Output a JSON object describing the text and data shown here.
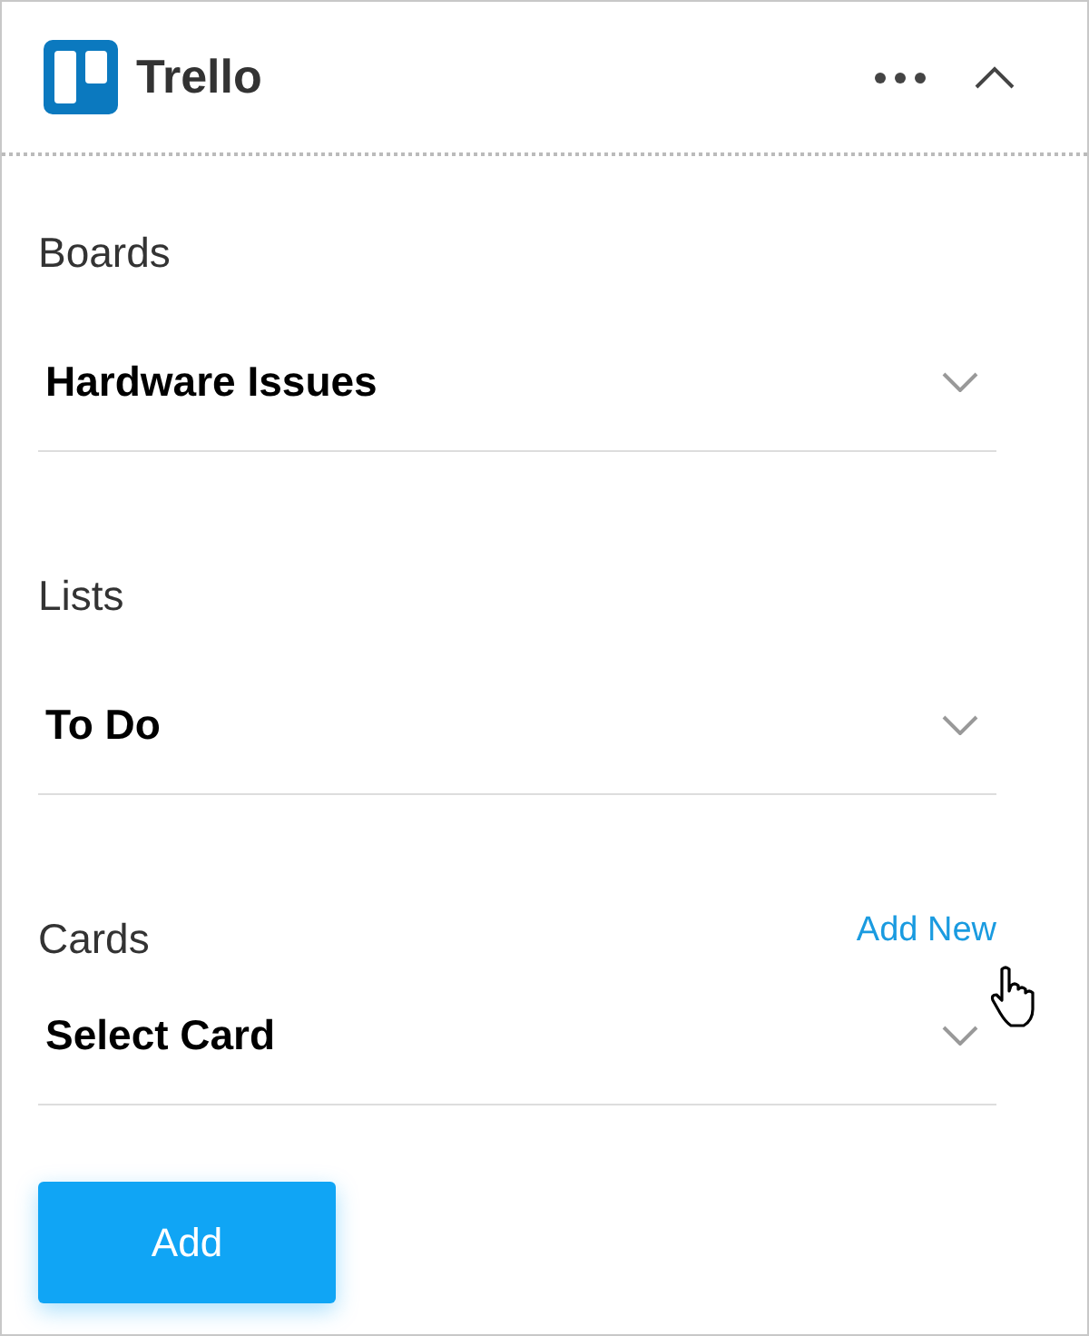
{
  "header": {
    "title": "Trello"
  },
  "fields": [
    {
      "label": "Boards",
      "value": "Hardware Issues"
    },
    {
      "label": "Lists",
      "value": "To Do"
    },
    {
      "label": "Cards",
      "value": "Select Card",
      "action": "Add New"
    }
  ],
  "button": "Add"
}
